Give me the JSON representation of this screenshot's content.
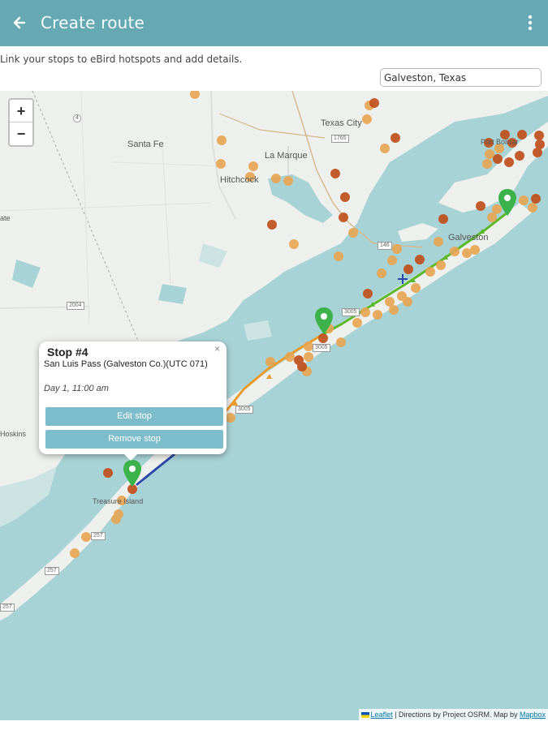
{
  "header": {
    "title": "Create route",
    "back_icon": "arrow-left-icon",
    "menu_icon": "more-vert-icon"
  },
  "subtitle": "Link your stops to eBird hotspots and add details.",
  "search": {
    "value": "Galveston, Texas"
  },
  "map": {
    "zoom_in": "+",
    "zoom_out": "−",
    "labels": {
      "texas_city": "Texas City",
      "santa_fe": "Santa Fe",
      "la_marque": "La Marque",
      "hitchcock": "Hitchcock",
      "port_bolivar": "Port Bolivar",
      "galveston": "Galveston",
      "hoskins": "Hoskins",
      "treasure_island": "Treasure Island",
      "state": "ate"
    },
    "road_shields": {
      "r4": "4",
      "r1765": "1765",
      "r2004": "2004",
      "r3005a": "3005",
      "r3005b": "3005",
      "r3005c": "3005",
      "r257a": "257",
      "r257b": "257",
      "r257c": "257",
      "r146": "146"
    },
    "colors": {
      "water": "#a8d3d6",
      "land": "#eef0ee",
      "hotspot_dark": "#c0501c",
      "hotspot_light": "#e8a552",
      "marker": "#3cb34a",
      "route_green": "#5cb82a",
      "route_orange": "#e89a2a",
      "route_blue": "#2b4aa8"
    }
  },
  "popup": {
    "title": "Stop #4",
    "close": "×",
    "hotspot_name": "San Luis Pass (Galveston Co.)(UTC 071)",
    "time": "Day 1, 11:00 am",
    "edit_button": "Edit stop",
    "remove_button": "Remove stop"
  },
  "attribution": {
    "leaflet": "Leaflet",
    "osrm": " | Directions by Project OSRM. Map by ",
    "mapbox": "Mapbox"
  }
}
